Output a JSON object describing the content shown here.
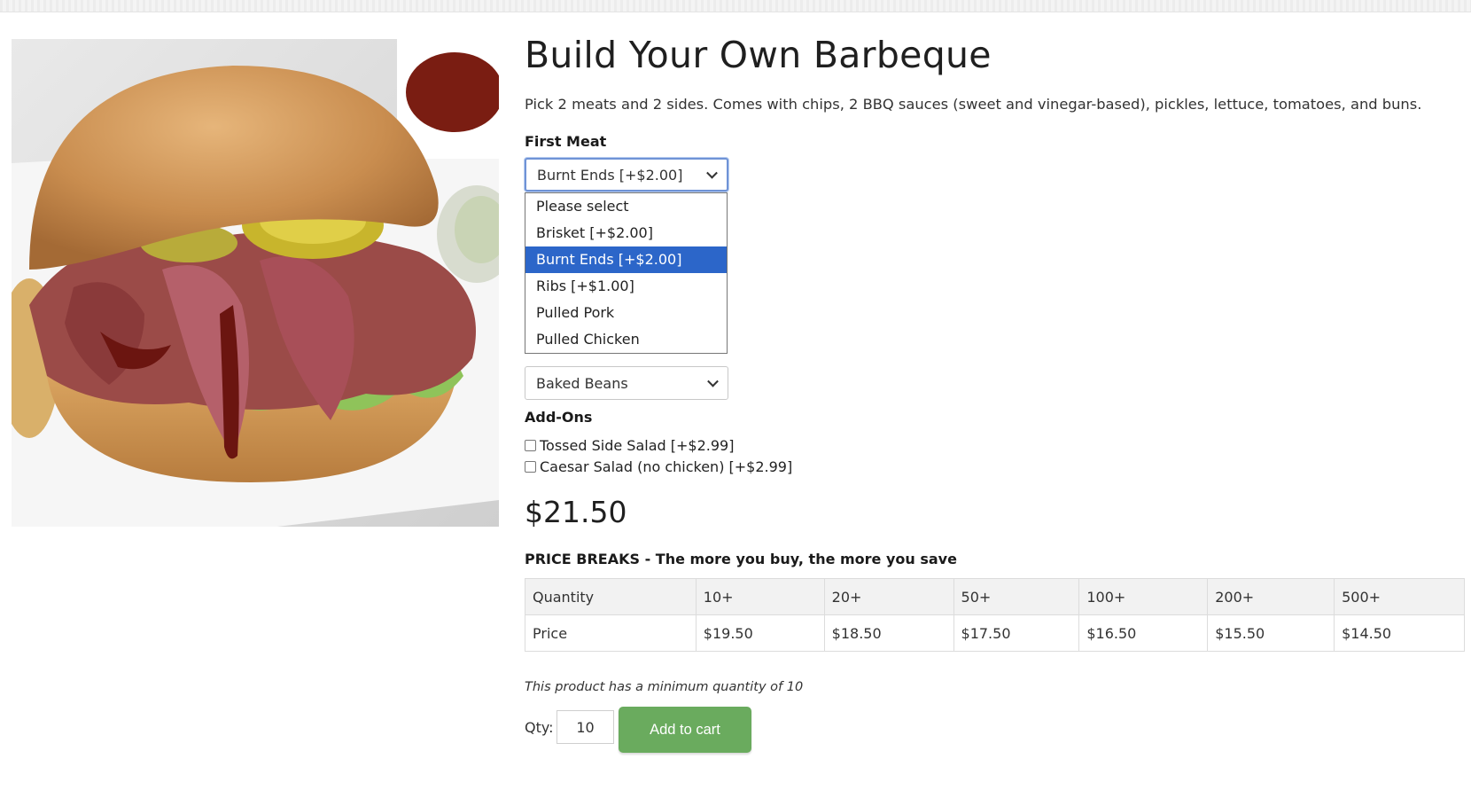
{
  "product": {
    "title": "Build Your Own Barbeque",
    "description": "Pick 2 meats and 2 sides. Comes with chips, 2 BBQ sauces (sweet and vinegar-based), pickles, lettuce, tomatoes, and buns.",
    "image_alt": "BBQ sandwich"
  },
  "first_meat": {
    "label": "First Meat",
    "selected": "Burnt Ends [+$2.00]",
    "options": [
      {
        "label": "Please select",
        "highlighted": false
      },
      {
        "label": "Brisket [+$2.00]",
        "highlighted": false
      },
      {
        "label": "Burnt Ends [+$2.00]",
        "highlighted": true
      },
      {
        "label": "Ribs [+$1.00]",
        "highlighted": false
      },
      {
        "label": "Pulled Pork",
        "highlighted": false
      },
      {
        "label": "Pulled Chicken",
        "highlighted": false
      }
    ]
  },
  "second_side": {
    "selected": "Baked Beans"
  },
  "addons": {
    "label": "Add-Ons",
    "items": [
      {
        "label": "Tossed Side Salad [+$2.99]",
        "checked": false
      },
      {
        "label": "Caesar Salad (no chicken) [+$2.99]",
        "checked": false
      }
    ]
  },
  "price": "$21.50",
  "price_breaks": {
    "title": "PRICE BREAKS - The more you buy, the more you save",
    "quantity_row": [
      "Quantity",
      "10+",
      "20+",
      "50+",
      "100+",
      "200+",
      "500+"
    ],
    "price_row": [
      "Price",
      "$19.50",
      "$18.50",
      "$17.50",
      "$16.50",
      "$15.50",
      "$14.50"
    ]
  },
  "min_quantity_note": "This product has a minimum quantity of 10",
  "cart": {
    "qty_label": "Qty:",
    "qty_value": "10",
    "add_button": "Add to cart"
  },
  "colors": {
    "accent_green": "#6aab5e",
    "select_highlight": "#2c66c9"
  }
}
